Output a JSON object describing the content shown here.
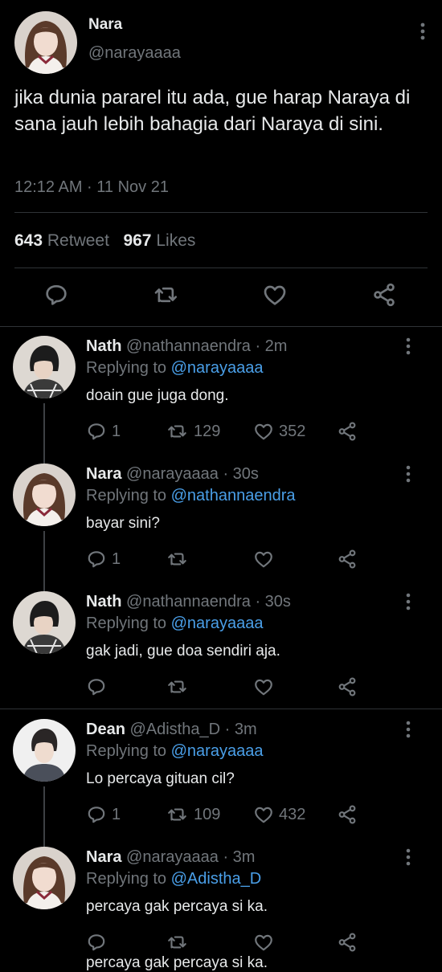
{
  "main_tweet": {
    "name": "Nara",
    "handle": "@narayaaaa",
    "text": "jika dunia pararel itu ada, gue harap Naraya di sana jauh lebih bahagia dari Naraya di sini.",
    "time": "12:12 AM · 11 Nov 21",
    "retweet_count": "643",
    "retweet_label": "Retweet",
    "like_count": "967",
    "like_label": "Likes"
  },
  "replies": [
    {
      "name": "Nath",
      "handle": "@nathannaendra",
      "age": "· 2m",
      "replying_prefix": "Replying to",
      "replying_to": "@narayaaaa",
      "text": "doain gue juga dong.",
      "reply_count": "1",
      "retweet_count": "129",
      "like_count": "352",
      "avatar": "boy-dark-hair-icon"
    },
    {
      "name": "Nara",
      "handle": "@narayaaaa",
      "age": "· 30s",
      "replying_prefix": "Replying to",
      "replying_to": "@nathannaendra",
      "text": "bayar sini?",
      "reply_count": "1",
      "retweet_count": "",
      "like_count": "",
      "avatar": "girl-brown-hair-icon"
    },
    {
      "name": "Nath",
      "handle": "@nathannaendra",
      "age": "· 30s",
      "replying_prefix": "Replying to",
      "replying_to": "@narayaaaa",
      "text": "gak jadi, gue doa sendiri aja.",
      "reply_count": "",
      "retweet_count": "",
      "like_count": "",
      "avatar": "boy-dark-hair-icon"
    },
    {
      "name": "Dean",
      "handle": "@Adistha_D",
      "age": "· 3m",
      "replying_prefix": "Replying to",
      "replying_to": "@narayaaaa",
      "text": "Lo percaya gituan cil?",
      "reply_count": "1",
      "retweet_count": "109",
      "like_count": "432",
      "avatar": "boy-light-background-icon"
    },
    {
      "name": "Nara",
      "handle": "@narayaaaa",
      "age": "· 3m",
      "replying_prefix": "Replying to",
      "replying_to": "@Adistha_D",
      "text": "percaya gak percaya si ka.",
      "reply_count": "",
      "retweet_count": "",
      "like_count": "",
      "avatar": "girl-brown-hair-icon"
    }
  ],
  "cutoff_text": "percaya gak percaya si ka.",
  "colors": {
    "background": "#000000",
    "text": "#e7e9ea",
    "secondary": "#71767b",
    "link": "#4a9fe8",
    "divider": "#2f3336"
  }
}
